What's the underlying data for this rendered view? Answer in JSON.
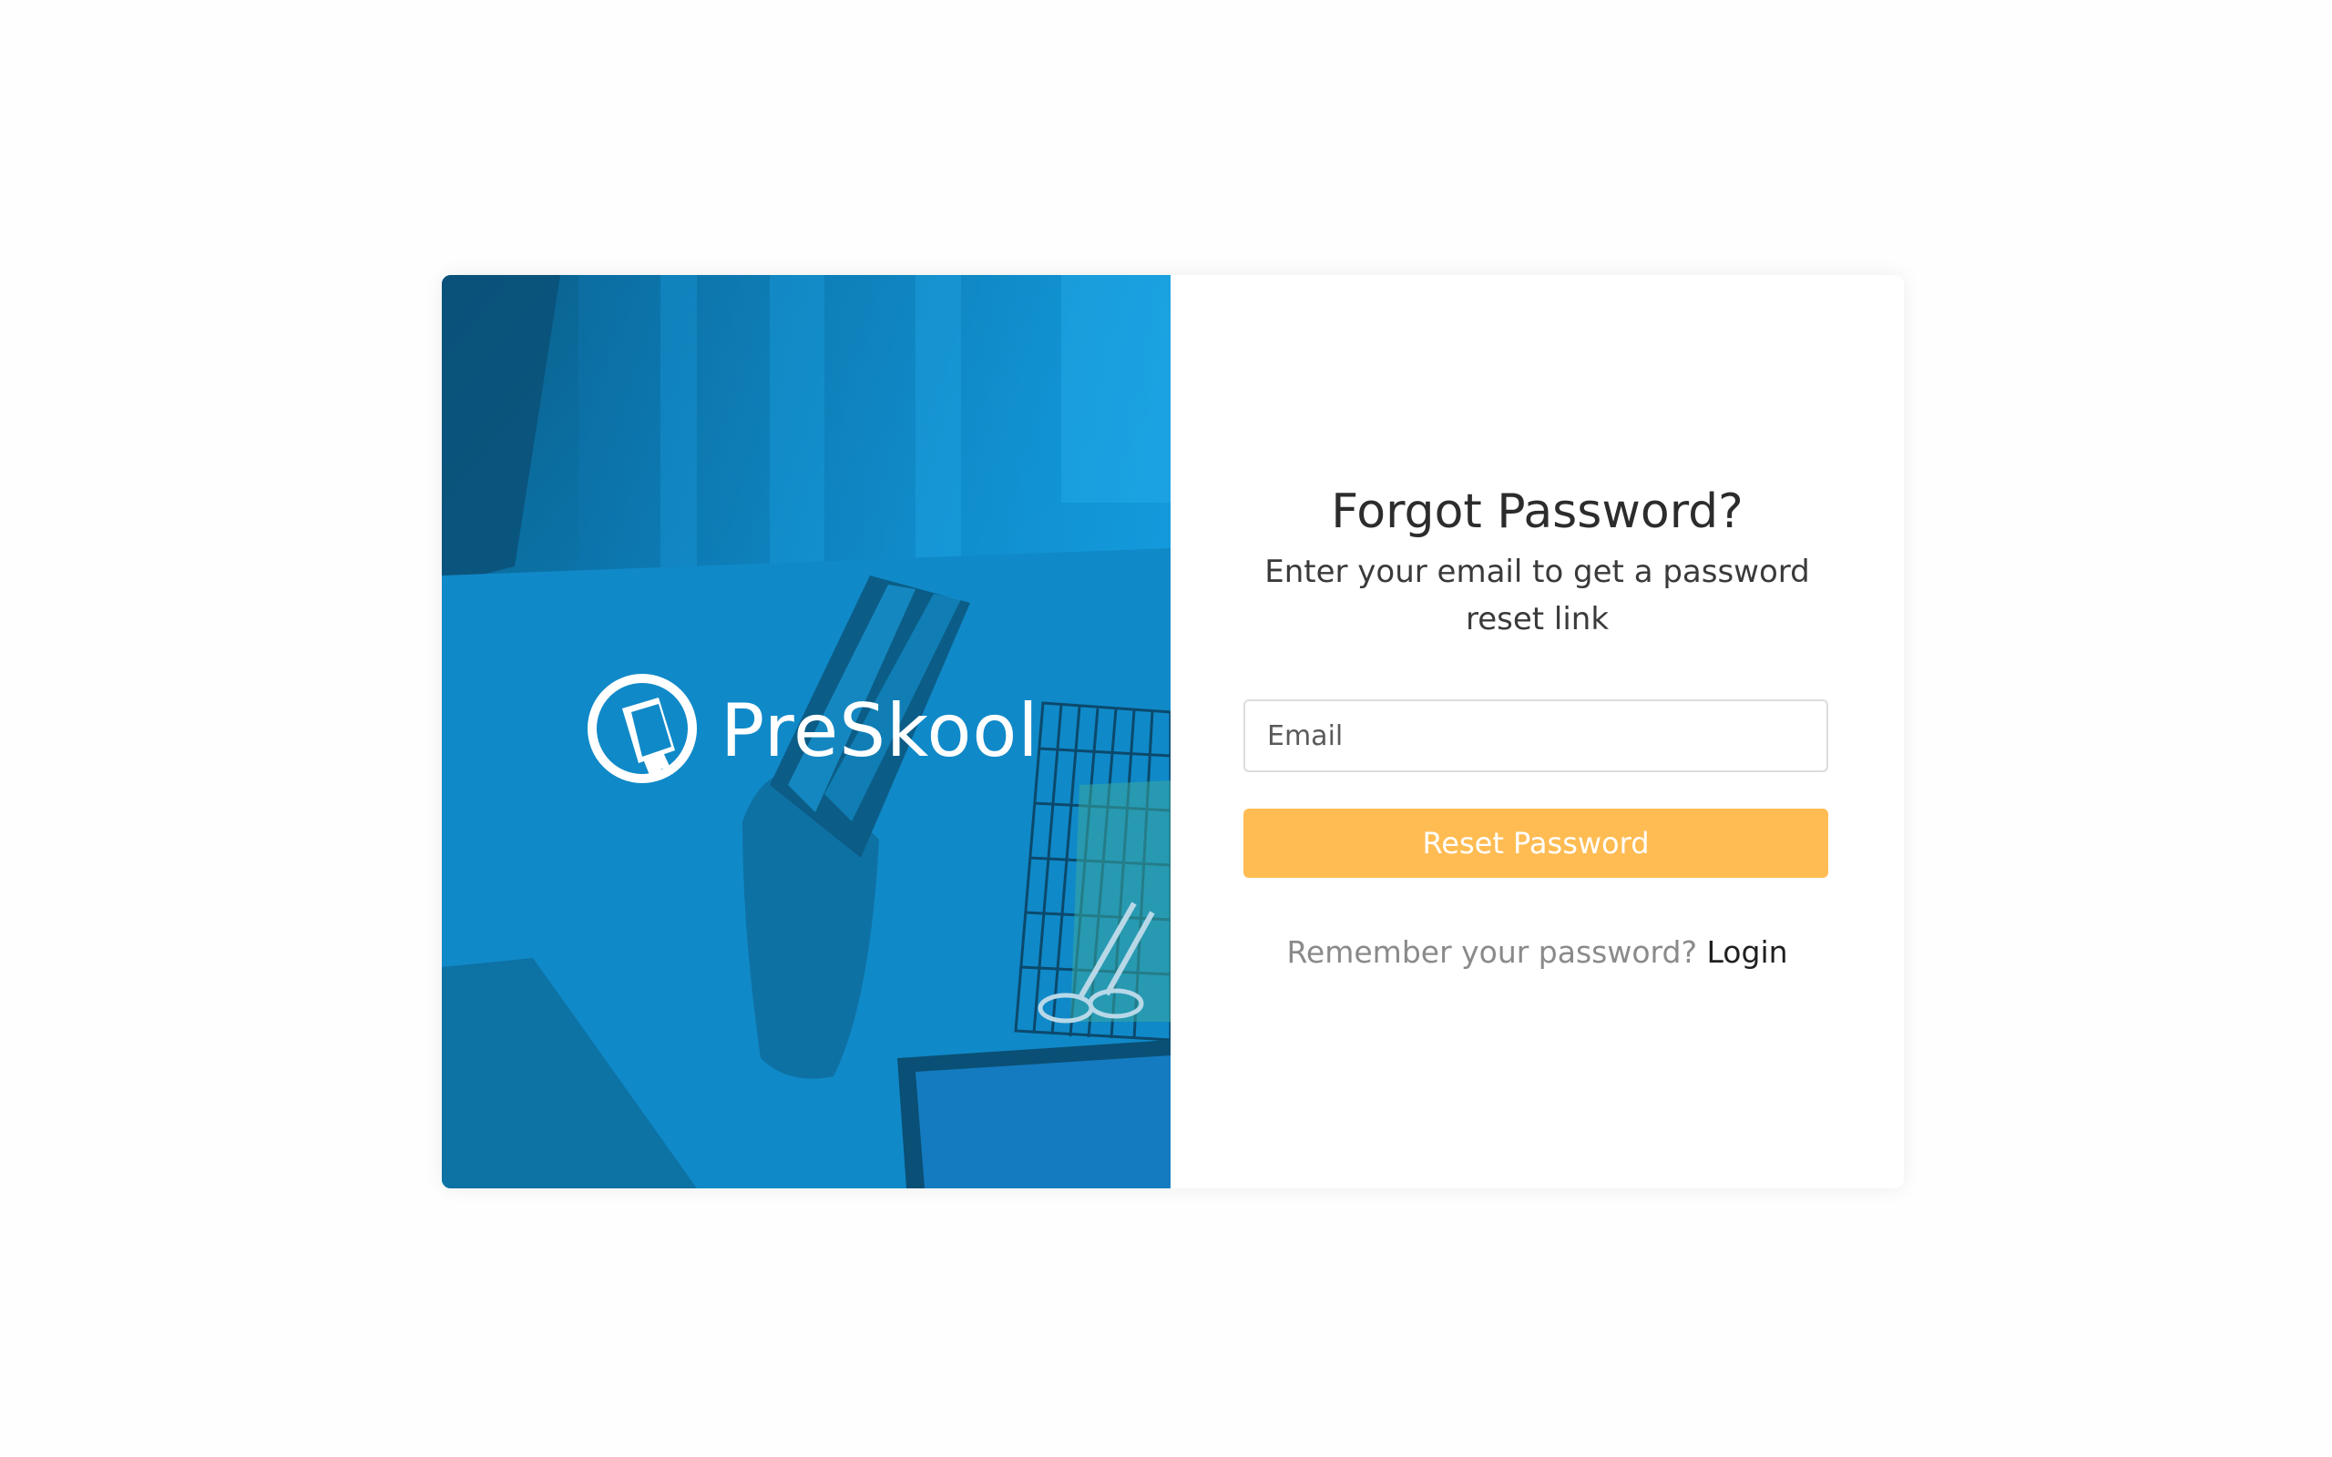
{
  "brand": {
    "name": "PreSkool"
  },
  "form": {
    "title": "Forgot Password?",
    "subtitle": "Enter your email to get a password reset link",
    "email_placeholder": "Email",
    "email_value": "",
    "submit_label": "Reset Password"
  },
  "footer": {
    "prompt": "Remember your password?",
    "link_label": "Login"
  },
  "colors": {
    "accent": "#ffbc53",
    "panel_blue": "#0f8ccc"
  }
}
